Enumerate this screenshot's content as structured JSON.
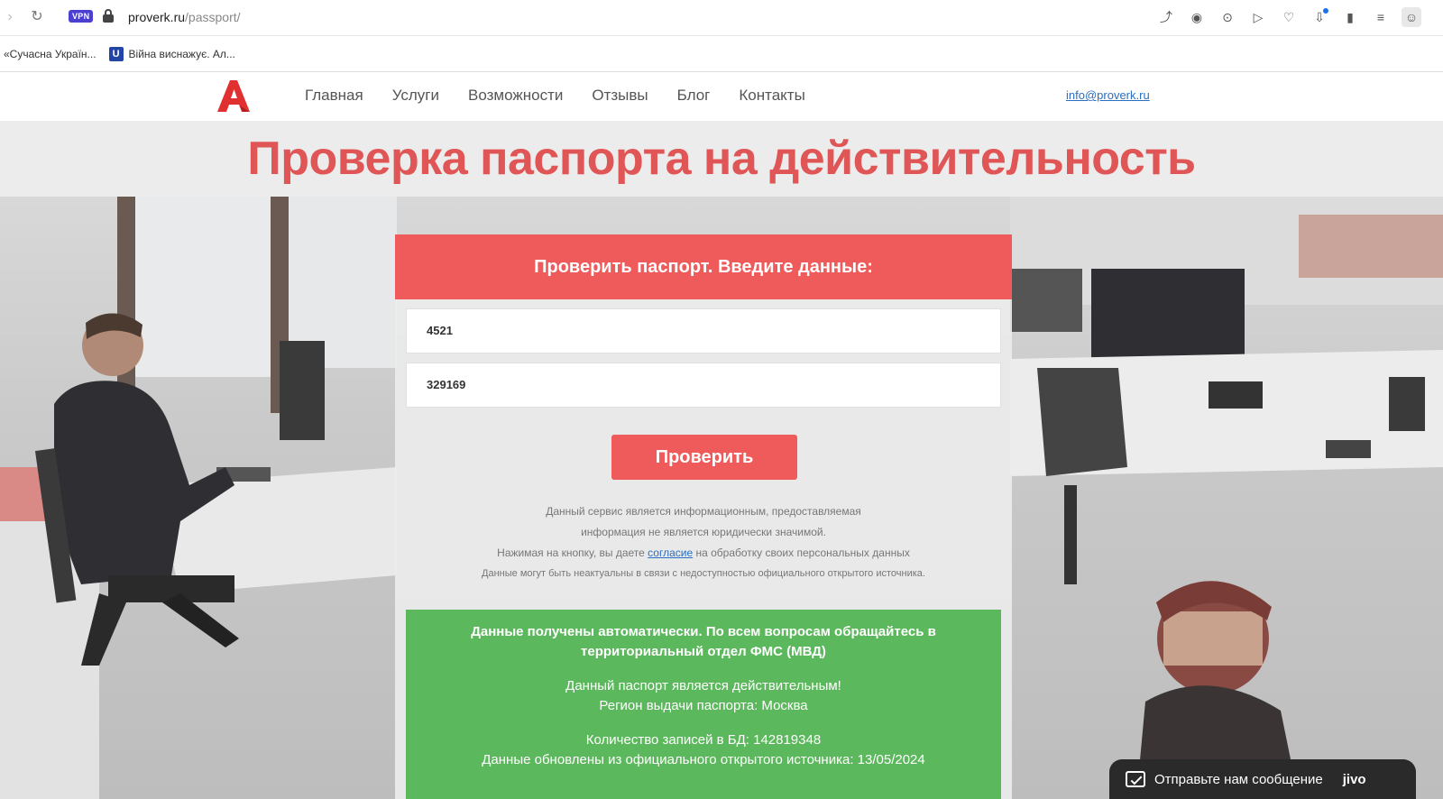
{
  "browser": {
    "url_host": "proverk.ru",
    "url_path": "/passport/",
    "vpn_badge": "VPN",
    "bookmarks": [
      {
        "label": "«Сучасна Україн..."
      },
      {
        "label": "Війна виснажує. Ал...",
        "icon": "U"
      }
    ]
  },
  "site": {
    "nav": [
      "Главная",
      "Услуги",
      "Возможности",
      "Отзывы",
      "Блог",
      "Контакты"
    ],
    "email": "info@proverk.ru",
    "title": "Проверка паспорта на действительность"
  },
  "form": {
    "heading": "Проверить паспорт. Введите данные:",
    "series_value": "4521",
    "number_value": "329169",
    "submit_label": "Проверить",
    "disclaimer_line1": "Данный сервис является информационным, предоставляемая",
    "disclaimer_line2": "информация не является юридически значимой.",
    "consent_before": "Нажимая на кнопку, вы даете ",
    "consent_link": "согласие",
    "consent_after": " на обработку своих персональных данных",
    "disclaimer_line4": "Данные могут быть неактуальны в связи с недоступностью официального открытого источника."
  },
  "result": {
    "heading": "Данные получены автоматически. По всем вопросам обращайтесь в территориальный отдел ФМС (МВД)",
    "status": "Данный паспорт является действительным!",
    "region": "Регион выдачи паспорта: Москва",
    "records": "Количество записей в БД: 142819348",
    "updated": "Данные обновлены из официального открытого источника: 13/05/2024"
  },
  "chat": {
    "label": "Отправьте нам сообщение",
    "brand": "jivo"
  },
  "colors": {
    "accent_red": "#ef5a5a",
    "result_green": "#5cb85c",
    "link_blue": "#2a6fc2"
  }
}
